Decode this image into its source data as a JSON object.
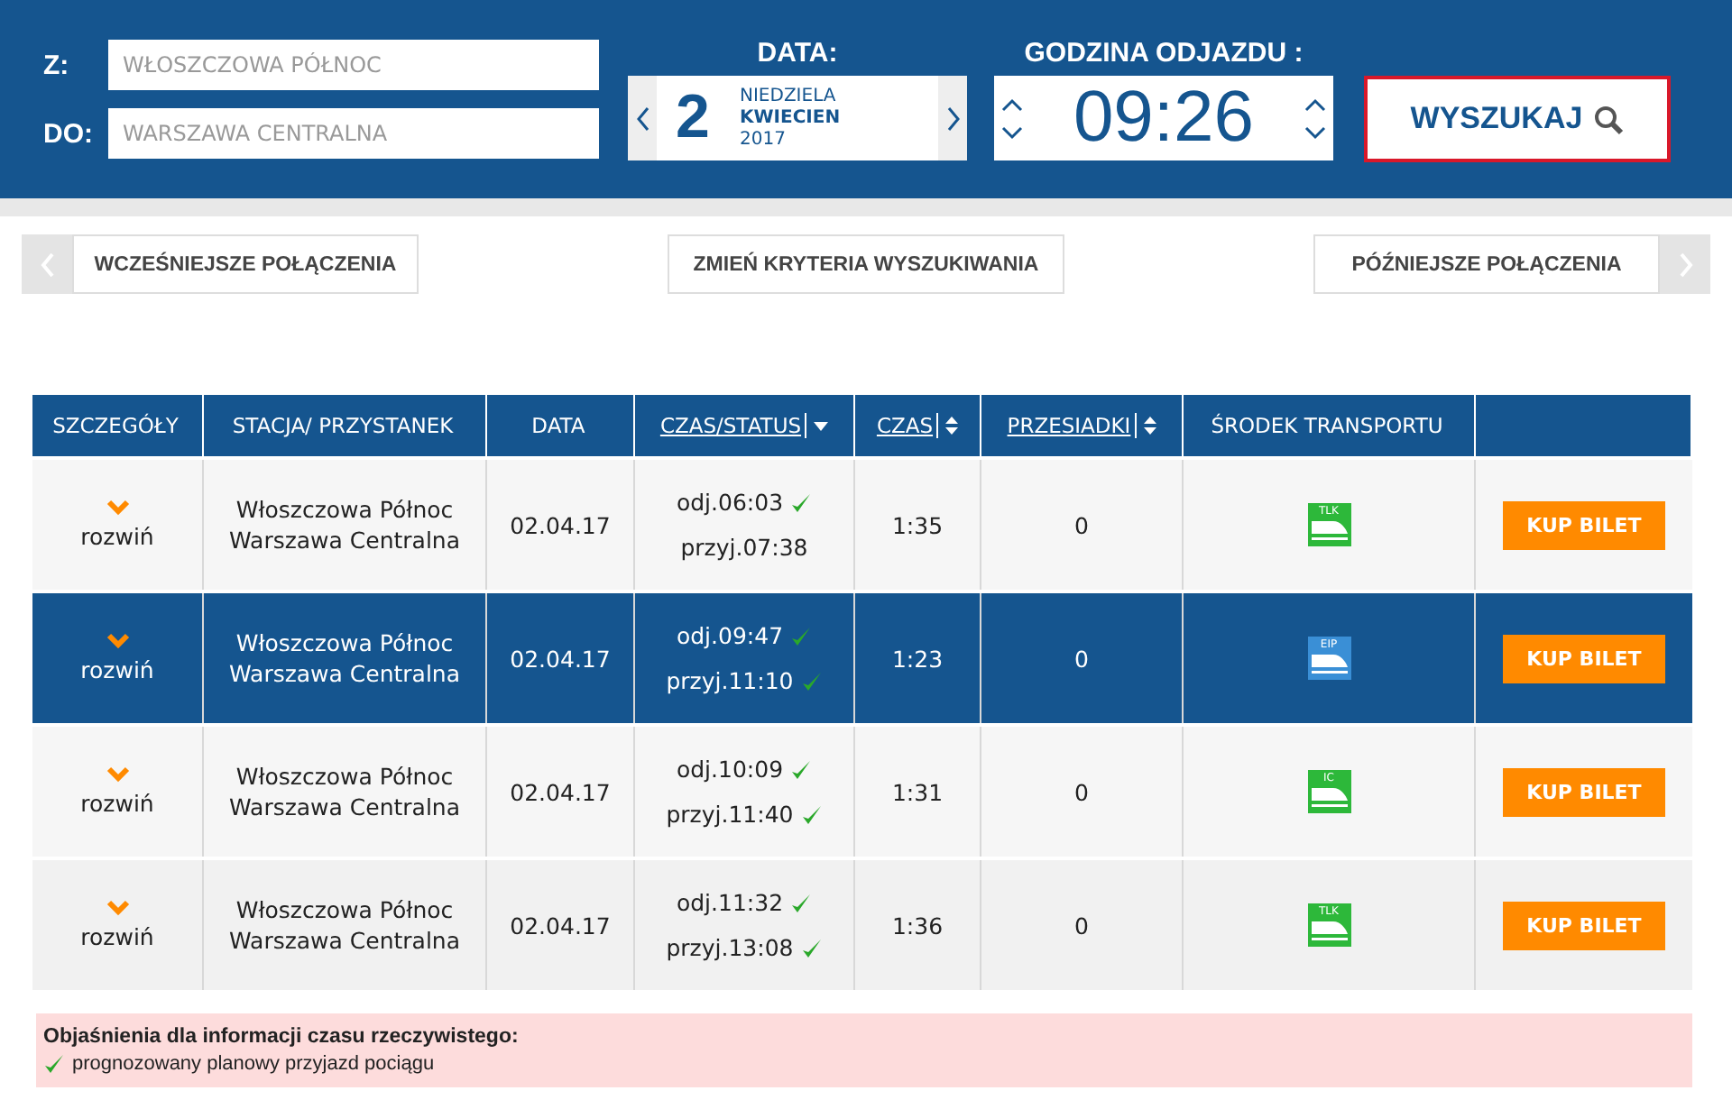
{
  "search": {
    "from_label": "Z:",
    "from_field": {
      "placeholder": "WŁOSZCZOWA PÓŁNOC"
    },
    "to_label": "DO:",
    "to_field": {
      "placeholder": "WARSZAWA CENTRALNA"
    },
    "date_label": "DATA:",
    "day": "2",
    "weekday": "NIEDZIELA",
    "month": "KWIECIEN",
    "year": "2017",
    "time_label": "GODZINA ODJAZDU :",
    "time": "09:26",
    "search_button": "WYSZUKAJ"
  },
  "nav": {
    "earlier": "WCZEŚNIEJSZE POŁĄCZENIA",
    "change": "ZMIEŃ KRYTERIA WYSZUKIWANIA",
    "later": "PÓŹNIEJSZE POŁĄCZENIA"
  },
  "table": {
    "columns": [
      {
        "label": "SZCZEGÓŁY",
        "kind": "plain"
      },
      {
        "label": "STACJA/ PRZYSTANEK",
        "kind": "plain"
      },
      {
        "label": "DATA",
        "kind": "plain"
      },
      {
        "label": "CZAS/STATUS",
        "kind": "sorted"
      },
      {
        "label": "CZAS",
        "kind": "sortable"
      },
      {
        "label": "PRZESIADKI",
        "kind": "sortable"
      },
      {
        "label": "ŚRODEK TRANSPORTU",
        "kind": "plain"
      }
    ],
    "rows": [
      {
        "selected": false,
        "expand": "rozwiń",
        "from": "Włoszczowa Północ",
        "to": "Warszawa Centralna",
        "date": "02.04.17",
        "departure": "odj.06:03",
        "departure_confirmed": true,
        "arrival": "przyj.07:38",
        "arrival_confirmed": false,
        "duration": "1:35",
        "changes": "0",
        "train": {
          "label": "TLK",
          "color": "#2db83a"
        },
        "buy": "KUP BILET"
      },
      {
        "selected": true,
        "expand": "rozwiń",
        "from": "Włoszczowa Północ",
        "to": "Warszawa Centralna",
        "date": "02.04.17",
        "departure": "odj.09:47",
        "departure_confirmed": true,
        "arrival": "przyj.11:10",
        "arrival_confirmed": true,
        "duration": "1:23",
        "changes": "0",
        "train": {
          "label": "EIP",
          "color": "#3a8fd6"
        },
        "buy": "KUP BILET"
      },
      {
        "selected": false,
        "expand": "rozwiń",
        "from": "Włoszczowa Północ",
        "to": "Warszawa Centralna",
        "date": "02.04.17",
        "departure": "odj.10:09",
        "departure_confirmed": true,
        "arrival": "przyj.11:40",
        "arrival_confirmed": true,
        "duration": "1:31",
        "changes": "0",
        "train": {
          "label": "IC",
          "color": "#2db83a"
        },
        "buy": "KUP BILET"
      },
      {
        "selected": false,
        "expand": "rozwiń",
        "from": "Włoszczowa Północ",
        "to": "Warszawa Centralna",
        "date": "02.04.17",
        "departure": "odj.11:32",
        "departure_confirmed": true,
        "arrival": "przyj.13:08",
        "arrival_confirmed": true,
        "duration": "1:36",
        "changes": "0",
        "train": {
          "label": "TLK",
          "color": "#2db83a"
        },
        "buy": "KUP BILET"
      }
    ]
  },
  "legend": {
    "title": "Objaśnienia dla informacji czasu rzeczywistego:",
    "item": "prognozowany planowy przyjazd pociągu"
  }
}
